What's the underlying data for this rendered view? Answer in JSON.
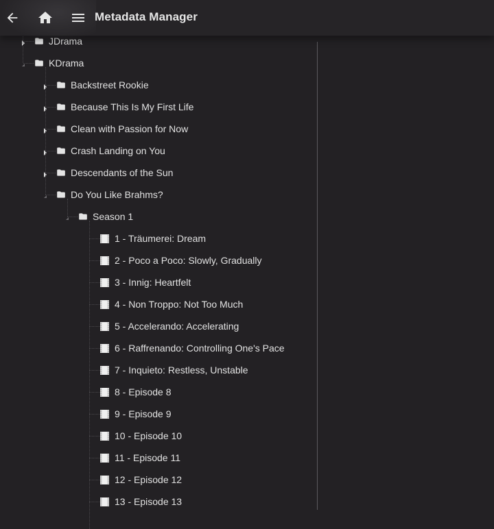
{
  "header": {
    "back_icon": "arrow-left-icon",
    "home_icon": "home-icon",
    "menu_icon": "hamburger-menu-icon",
    "title": "Metadata Manager"
  },
  "colors": {
    "background": "#232124",
    "header": "#262427",
    "text": "#e2e2e2",
    "divider": "#5c5a5e"
  },
  "tree": [
    {
      "level": 1,
      "label": "JDrama",
      "type": "folder",
      "expanded": false
    },
    {
      "level": 1,
      "label": "KDrama",
      "type": "folder",
      "expanded": true
    },
    {
      "level": 2,
      "label": "Backstreet Rookie",
      "type": "folder",
      "expanded": false
    },
    {
      "level": 2,
      "label": "Because This Is My First Life",
      "type": "folder",
      "expanded": false
    },
    {
      "level": 2,
      "label": "Clean with Passion for Now",
      "type": "folder",
      "expanded": false
    },
    {
      "level": 2,
      "label": "Crash Landing on You",
      "type": "folder",
      "expanded": false
    },
    {
      "level": 2,
      "label": "Descendants of the Sun",
      "type": "folder",
      "expanded": false
    },
    {
      "level": 2,
      "label": "Do You Like Brahms?",
      "type": "folder",
      "expanded": true
    },
    {
      "level": 3,
      "label": "Season 1",
      "type": "folder",
      "expanded": true
    },
    {
      "level": 4,
      "label": "1 - Träumerei: Dream",
      "type": "episode"
    },
    {
      "level": 4,
      "label": "2 - Poco a Poco: Slowly, Gradually",
      "type": "episode"
    },
    {
      "level": 4,
      "label": "3 - Innig: Heartfelt",
      "type": "episode"
    },
    {
      "level": 4,
      "label": "4 - Non Troppo: Not Too Much",
      "type": "episode"
    },
    {
      "level": 4,
      "label": "5 - Accelerando: Accelerating",
      "type": "episode"
    },
    {
      "level": 4,
      "label": "6 - Raffrenando: Controlling One's Pace",
      "type": "episode"
    },
    {
      "level": 4,
      "label": "7 - Inquieto: Restless, Unstable",
      "type": "episode"
    },
    {
      "level": 4,
      "label": "8 - Episode 8",
      "type": "episode"
    },
    {
      "level": 4,
      "label": "9 - Episode 9",
      "type": "episode"
    },
    {
      "level": 4,
      "label": "10 - Episode 10",
      "type": "episode"
    },
    {
      "level": 4,
      "label": "11 - Episode 11",
      "type": "episode"
    },
    {
      "level": 4,
      "label": "12 - Episode 12",
      "type": "episode"
    },
    {
      "level": 4,
      "label": "13 - Episode 13",
      "type": "episode"
    }
  ]
}
